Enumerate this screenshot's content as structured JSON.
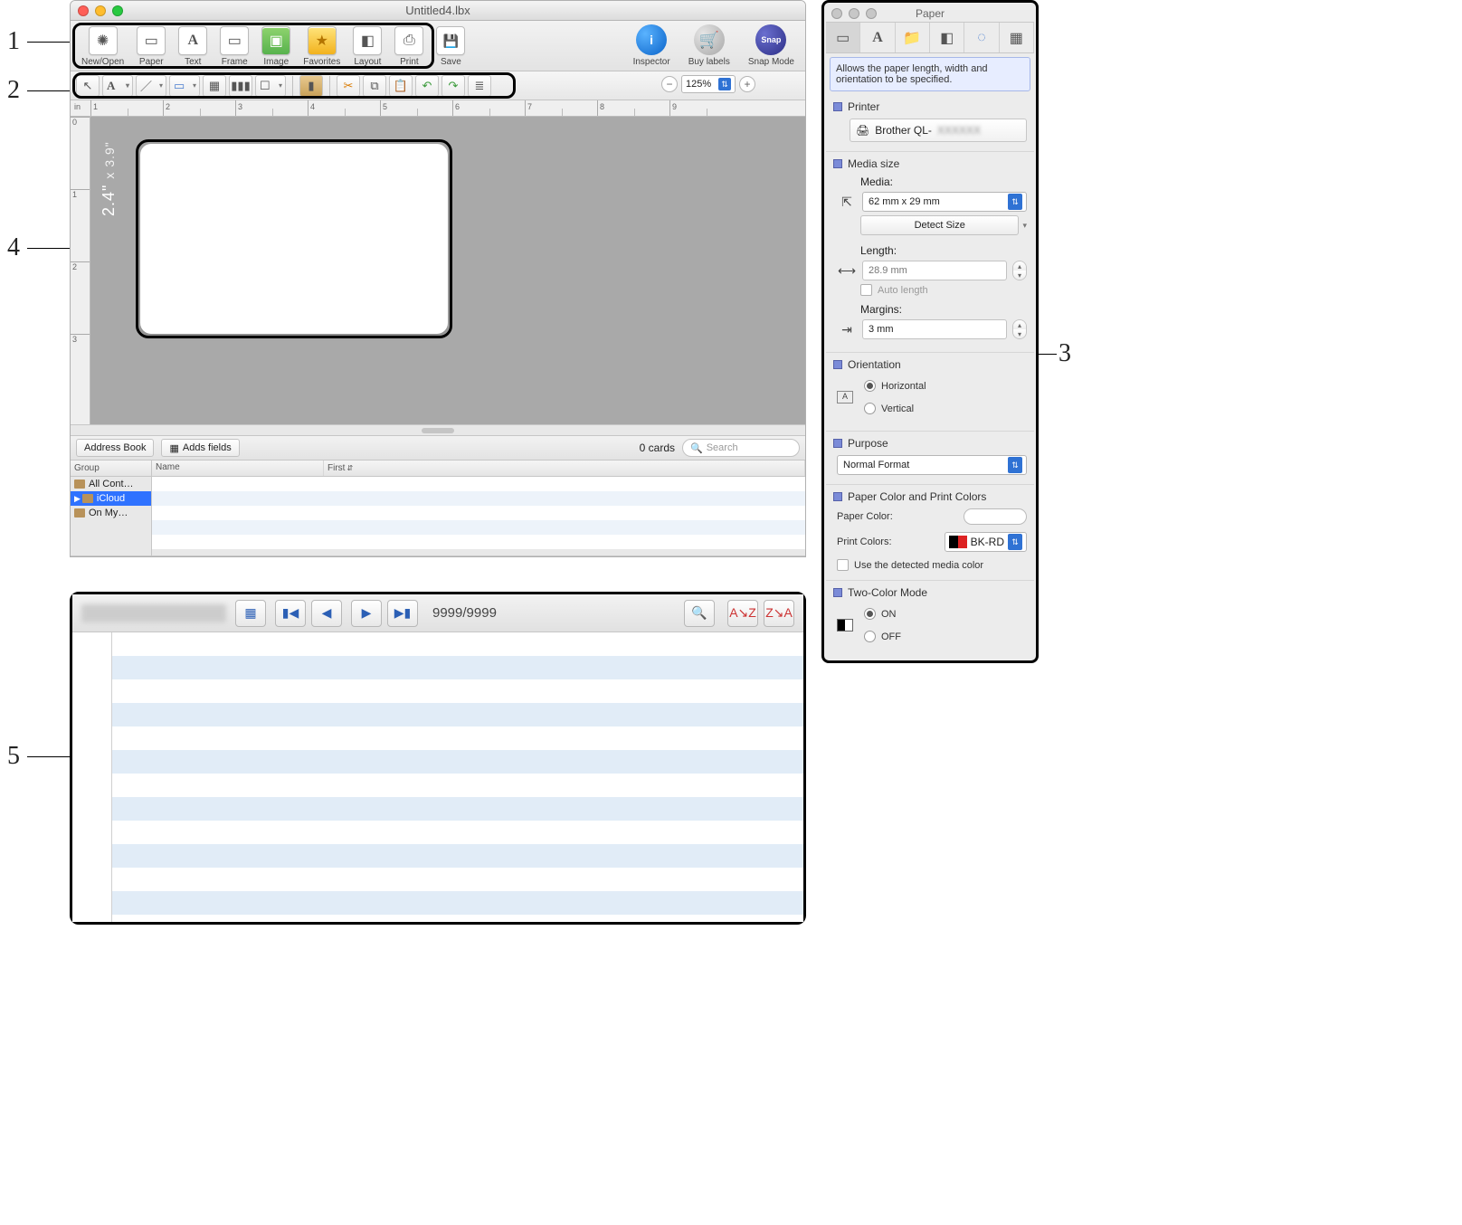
{
  "callouts": [
    "1",
    "2",
    "3",
    "4",
    "5"
  ],
  "window": {
    "title": "Untitled4.lbx"
  },
  "cmd_toolbar": {
    "items": [
      {
        "label": "New/Open",
        "glyph": "✺"
      },
      {
        "label": "Paper",
        "glyph": "▭"
      },
      {
        "label": "Text",
        "glyph": "A"
      },
      {
        "label": "Frame",
        "glyph": "▭"
      },
      {
        "label": "Image",
        "glyph": "▣"
      },
      {
        "label": "Favorites",
        "glyph": "★"
      },
      {
        "label": "Layout",
        "glyph": "◧"
      },
      {
        "label": "Print",
        "glyph": "⎙"
      },
      {
        "label": "Save",
        "glyph": "💾"
      }
    ],
    "right": [
      {
        "label": "Inspector",
        "glyph": "i"
      },
      {
        "label": "Buy labels",
        "glyph": "🛒"
      },
      {
        "label": "Snap Mode",
        "glyph": "Snap"
      }
    ]
  },
  "draw_toolbar": {
    "cursor": "↖",
    "text": "A",
    "line": "／",
    "rect": "▭",
    "table": "▦",
    "barcode": "▮▮▮",
    "speech": "☐",
    "book": "▮",
    "cut": "✂",
    "copy": "⧉",
    "paste": "📋",
    "undo": "↶",
    "redo": "↷",
    "align": "≣"
  },
  "zoom": {
    "minus": "−",
    "value": "125%",
    "plus": "+"
  },
  "ruler_unit": "in",
  "ruler_h": [
    "1",
    "2",
    "3",
    "4",
    "5",
    "6",
    "7",
    "8",
    "9"
  ],
  "ruler_v": [
    "0",
    "1",
    "2",
    "3"
  ],
  "label_size": {
    "big": "2.4\"",
    "sub": "x 3.9\""
  },
  "address_bar": {
    "btn1": "Address Book",
    "btn2": "Adds fields",
    "cards": "0 cards",
    "search_placeholder": "Search"
  },
  "ab_cols": {
    "group": "Group",
    "name": "Name",
    "first": "First"
  },
  "groups": [
    "All Cont…",
    "iCloud",
    "On My…"
  ],
  "inspector": {
    "title": "Paper",
    "hint": "Allows the paper length, width and orientation to be specified.",
    "printer_label": "Printer",
    "printer_value_prefix": "Brother QL-",
    "media_size": "Media size",
    "media_label": "Media:",
    "media_value": "62 mm x 29 mm",
    "detect": "Detect Size",
    "length_label": "Length:",
    "length_value": "28.9 mm",
    "auto_length": "Auto length",
    "margins_label": "Margins:",
    "margins_value": "3 mm",
    "orientation": "Orientation",
    "orient_h": "Horizontal",
    "orient_v": "Vertical",
    "purpose": "Purpose",
    "purpose_value": "Normal Format",
    "colors_section": "Paper Color and Print Colors",
    "paper_color": "Paper Color:",
    "print_colors": "Print Colors:",
    "print_colors_value": "BK-RD",
    "detected_media": "Use the detected media color",
    "two_color": "Two-Color Mode",
    "on": "ON",
    "off": "OFF"
  },
  "record": {
    "counter": "9999/9999"
  }
}
